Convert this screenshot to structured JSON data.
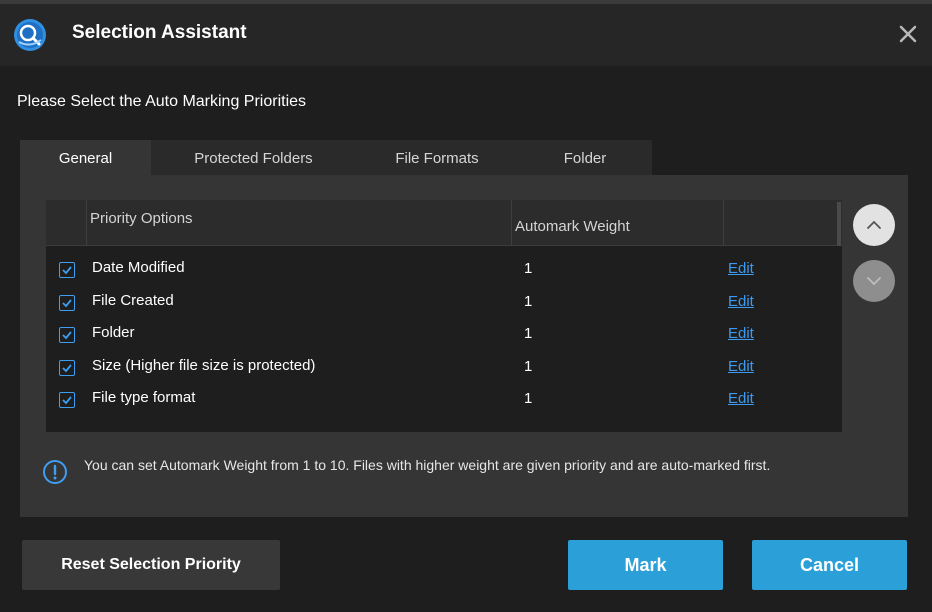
{
  "window": {
    "title": "Selection Assistant",
    "logo_icon": "magnifier-app-logo",
    "close_icon": "close-icon"
  },
  "heading": "Please Select the Auto Marking Priorities",
  "tabs": [
    {
      "label": "General",
      "active": true
    },
    {
      "label": "Protected Folders",
      "active": false
    },
    {
      "label": "File Formats",
      "active": false
    },
    {
      "label": "Folder",
      "active": false
    }
  ],
  "table": {
    "columns": [
      "Priority Options",
      "Automark Weight",
      ""
    ],
    "rows": [
      {
        "checked": true,
        "option": "Date Modified",
        "weight": "1",
        "action": "Edit"
      },
      {
        "checked": true,
        "option": "File Created",
        "weight": "1",
        "action": "Edit"
      },
      {
        "checked": true,
        "option": "Folder",
        "weight": "1",
        "action": "Edit"
      },
      {
        "checked": true,
        "option": "Size (Higher file size is protected)",
        "weight": "1",
        "action": "Edit"
      },
      {
        "checked": true,
        "option": "File type format",
        "weight": "1",
        "action": "Edit"
      }
    ]
  },
  "order_buttons": {
    "up_icon": "chevron-up-icon",
    "down_icon": "chevron-down-icon"
  },
  "info": {
    "icon": "info-icon",
    "text": "You can set Automark Weight from 1 to 10. Files with higher weight are given priority and are auto-marked first."
  },
  "buttons": {
    "reset": "Reset Selection Priority",
    "mark": "Mark",
    "cancel": "Cancel"
  },
  "colors": {
    "accent": "#2a9fd8",
    "link": "#3d9af0",
    "checkbox": "#3f9ef0"
  }
}
